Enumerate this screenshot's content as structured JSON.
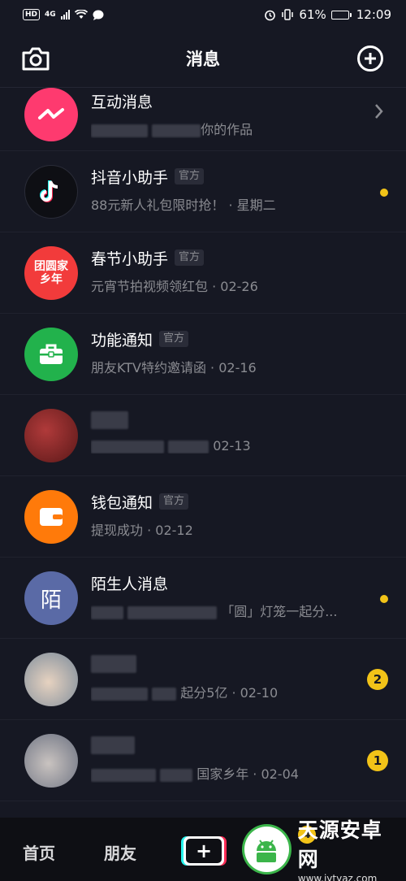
{
  "status_bar": {
    "hd": "HD",
    "network": "4G",
    "battery_pct": "61%",
    "time": "12:09",
    "battery_level": 0.61
  },
  "header": {
    "title": "消息",
    "camera_icon": "camera-icon",
    "add_icon": "plus-circle-icon"
  },
  "messages": [
    {
      "title": "互动消息",
      "subtitle": "你的作品",
      "avatar_color": "#fe3a6f",
      "icon": "interaction-icon",
      "right": "chevron"
    },
    {
      "title": "抖音小助手",
      "official": "官方",
      "subtitle": "88元新人礼包限时抢！ · 星期二",
      "avatar_color": "#0e0f14",
      "icon": "tiktok-icon",
      "right": "dot"
    },
    {
      "title": "春节小助手",
      "official": "官方",
      "subtitle": "元宵节拍视频领红包 · 02-26",
      "avatar_color": "#f23b3b",
      "icon": "spring-festival-icon",
      "avatar_text": "团圆家乡年",
      "right": "none"
    },
    {
      "title": "功能通知",
      "official": "官方",
      "subtitle": "朋友KTV特约邀请函 · 02-16",
      "avatar_color": "#22b24c",
      "icon": "toolbox-icon",
      "right": "none"
    },
    {
      "title": "",
      "subtitle": "02-13",
      "avatar_color": "#8a2a2a",
      "icon": "user-avatar",
      "right": "none"
    },
    {
      "title": "钱包通知",
      "official": "官方",
      "subtitle": "提现成功 · 02-12",
      "avatar_color": "#ff7a0a",
      "icon": "wallet-icon",
      "right": "none"
    },
    {
      "title": "陌生人消息",
      "subtitle": "「圆」灯笼一起分...",
      "avatar_color": "#5a6aa6",
      "avatar_text": "陌",
      "icon": "stranger-icon",
      "right": "dot"
    },
    {
      "title": "",
      "subtitle": "起分5亿 · 02-10",
      "avatar_color": "#c9b7a5",
      "icon": "user-avatar",
      "right": "count",
      "count": "2"
    },
    {
      "title": "",
      "subtitle": "国家乡年 · 02-04",
      "avatar_color": "#8b8f99",
      "icon": "user-avatar",
      "right": "count",
      "count": "1"
    }
  ],
  "tabbar": {
    "home": "首页",
    "friends": "朋友",
    "add_label": "+",
    "badge": "4"
  },
  "watermark": {
    "cn": "天源安卓网",
    "url": "www.jytyaz.com"
  }
}
